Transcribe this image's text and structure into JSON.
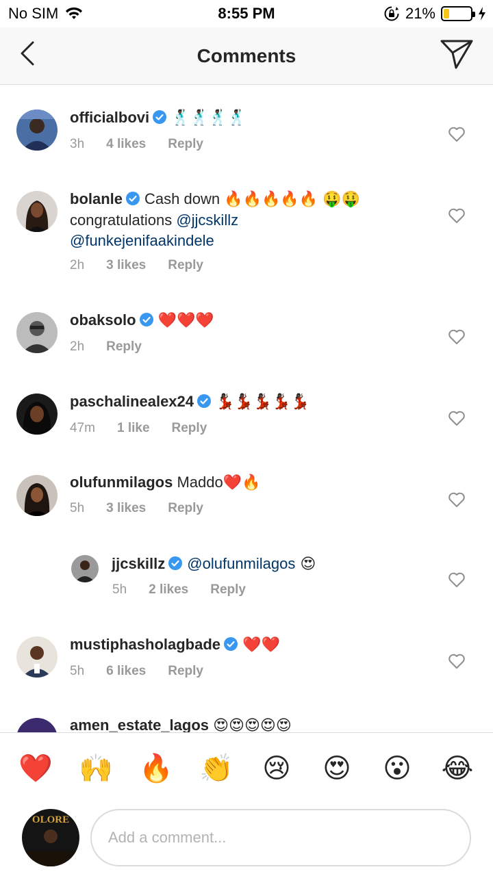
{
  "status_bar": {
    "carrier": "No SIM",
    "time": "8:55 PM",
    "battery": "21%",
    "battery_level": 0.21
  },
  "header": {
    "title": "Comments"
  },
  "comments": [
    {
      "username": "officialbovi",
      "text": "",
      "emoji": "🕺🏿🕺🏿🕺🏿🕺🏿",
      "time": "3h",
      "likes": "4 likes",
      "reply": "Reply"
    },
    {
      "username": "bolanle",
      "text": "Cash down ",
      "emoji": "🔥🔥🔥🔥🔥 🤑🤑",
      "line2": "congratulations ",
      "mention1": "@jjcskillz",
      "mention2": "@funkejenifaakindele",
      "time": "2h",
      "likes": "3 likes",
      "reply": "Reply"
    },
    {
      "username": "obaksolo",
      "text": "",
      "emoji": "❤️❤️❤️",
      "time": "2h",
      "likes": "",
      "reply": "Reply"
    },
    {
      "username": "paschalinealex24",
      "text": "",
      "emoji": "💃🏿💃🏿💃🏿💃🏿💃🏿",
      "time": "47m",
      "likes": "1 like",
      "reply": "Reply"
    },
    {
      "username": "olufunmilagos",
      "text": "Maddo",
      "emoji": "❤️🔥",
      "time": "5h",
      "likes": "3 likes",
      "reply": "Reply"
    },
    {
      "username": "jjcskillz",
      "mention": "@olufunmilagos",
      "emoji": " 😍",
      "time": "5h",
      "likes": "2 likes",
      "reply": "Reply"
    },
    {
      "username": "mustiphasholagbade",
      "text": "",
      "emoji": "❤️❤️",
      "time": "5h",
      "likes": "6 likes",
      "reply": "Reply"
    },
    {
      "username": "amen_estate_lagos",
      "text": "",
      "emoji": "😍😍😍😍😍"
    }
  ],
  "emoji_bar": [
    "❤️",
    "🙌",
    "🔥",
    "👏",
    "😢",
    "😍",
    "😮",
    "😂"
  ],
  "composer": {
    "placeholder": "Add a comment...",
    "avatar_text": "OLORE"
  },
  "colors": {
    "verified": "#3897f0",
    "mention": "#003569",
    "meta": "#999999",
    "border": "#dbdbdb"
  }
}
